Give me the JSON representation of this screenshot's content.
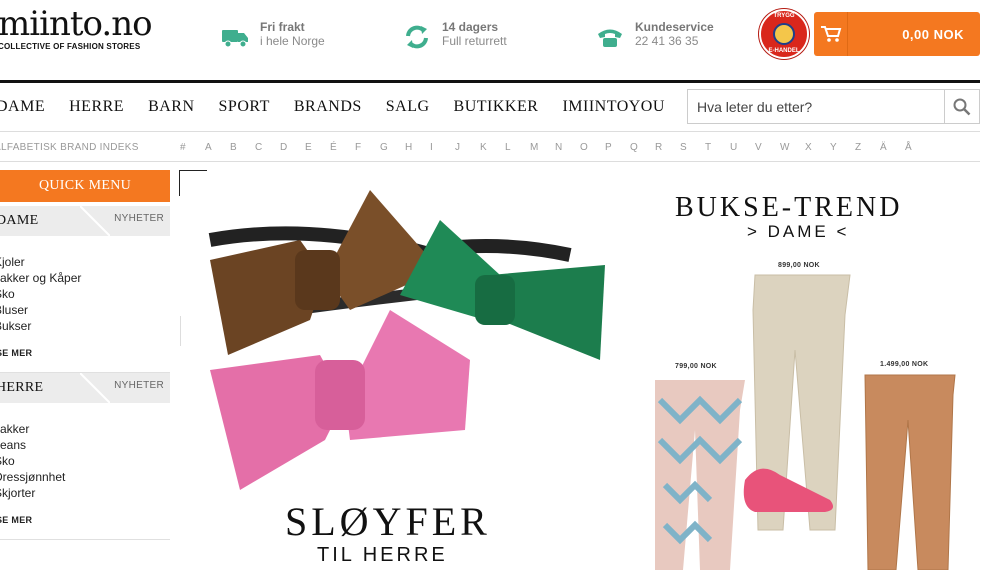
{
  "header": {
    "logo_text": "miinto.no",
    "logo_tagline": "COLLECTIVE OF FASHION STORES",
    "usps": [
      {
        "title": "Fri frakt",
        "subtitle": "i hele Norge",
        "icon": "truck-icon"
      },
      {
        "title": "14 dagers",
        "subtitle": "Full returrett",
        "icon": "return-arrows-icon"
      },
      {
        "title": "Kundeservice",
        "subtitle": "22 41 36 35",
        "icon": "phone-icon"
      }
    ],
    "trust_badge": {
      "top": "TRYGG",
      "bottom": "E-HANDEL"
    },
    "cart": {
      "amount": "0,00 NOK",
      "icon": "cart-icon"
    },
    "accent": "#f47820"
  },
  "nav": {
    "items": [
      "DAME",
      "HERRE",
      "BARN",
      "SPORT",
      "BRANDS",
      "SALG",
      "BUTIKKER",
      "IMIINTOYOU"
    ],
    "search_placeholder": "Hva leter du etter?"
  },
  "alphabet": {
    "label": "ALFABETISK BRAND INDEKS",
    "letters": [
      "#",
      "A",
      "B",
      "C",
      "D",
      "E",
      "É",
      "F",
      "G",
      "H",
      "I",
      "J",
      "K",
      "L",
      "M",
      "N",
      "O",
      "P",
      "Q",
      "R",
      "S",
      "T",
      "U",
      "V",
      "W",
      "X",
      "Y",
      "Z",
      "Ä",
      "Å"
    ]
  },
  "sidebar": {
    "quick_menu": "QUICK MENU",
    "sections": [
      {
        "name": "DAME",
        "news": "NYHETER",
        "items": [
          "Kjoler",
          "Jakker og Kåper",
          "Sko",
          "Bluser",
          "Bukser"
        ],
        "more": "SE MER"
      },
      {
        "name": "HERRE",
        "news": "NYHETER",
        "items": [
          "Jakker",
          "Jeans",
          "Sko",
          "Dressjønnhet",
          "Skjorter"
        ],
        "more": "SE MER"
      }
    ]
  },
  "banners": {
    "left": {
      "title": "SLØYFER",
      "subtitle": "TIL HERRE"
    },
    "right": {
      "title": "BUKSE-TREND",
      "subtitle": "> DAME <",
      "prices": [
        "899,00 NOK",
        "799,00 NOK",
        "1.499,00 NOK"
      ]
    }
  }
}
